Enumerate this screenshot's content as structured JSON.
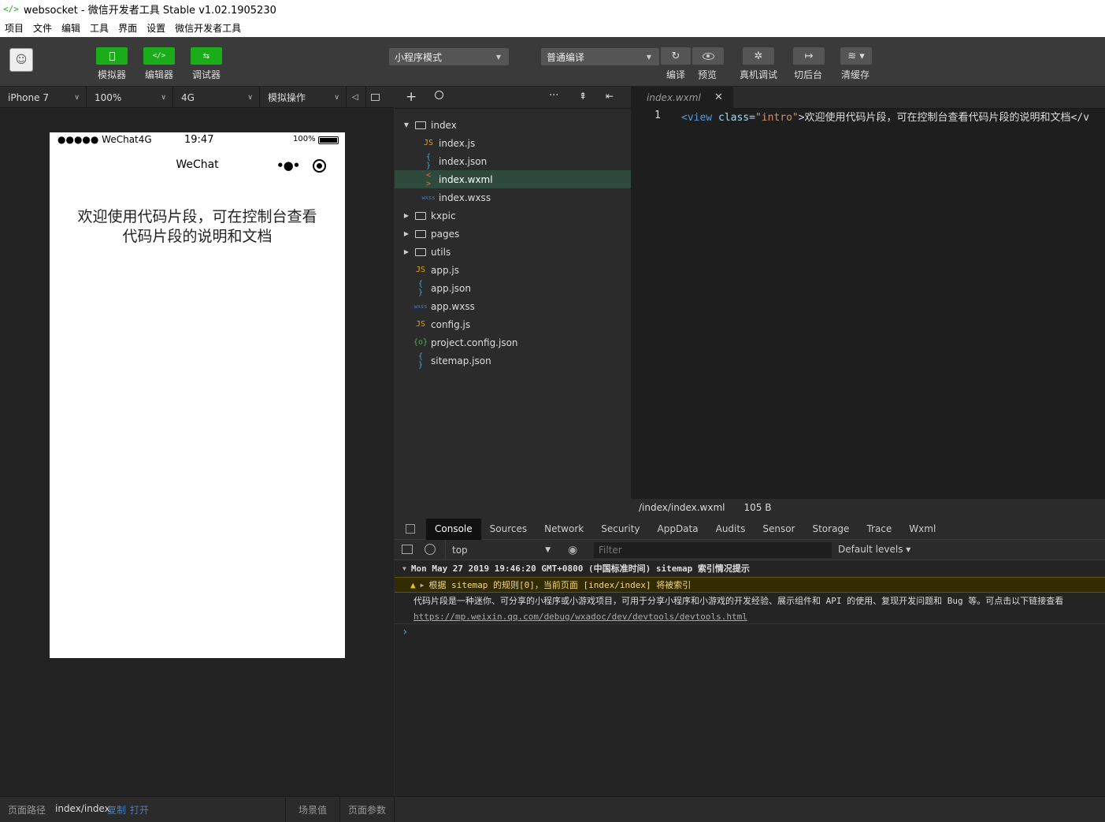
{
  "window": {
    "title": "websocket - 微信开发者工具 Stable v1.02.1905230"
  },
  "menu": [
    "项目",
    "文件",
    "编辑",
    "工具",
    "界面",
    "设置",
    "微信开发者工具"
  ],
  "toolbar": {
    "simulator_label": "模拟器",
    "editor_label": "编辑器",
    "debugger_label": "调试器",
    "mode_select": "小程序模式",
    "compile_select": "普通编译",
    "compile_label": "编译",
    "preview_label": "预览",
    "remote_debug_label": "真机调试",
    "background_label": "切后台",
    "clear_cache_label": "清缓存",
    "accent": "#1aad19"
  },
  "simbar": {
    "device": "iPhone 7",
    "zoom": "100%",
    "network": "4G",
    "ops": "模拟操作"
  },
  "phone": {
    "signal": "●●●●● WeChat4G",
    "time": "19:47",
    "battery": "100%",
    "nav_title": "WeChat",
    "intro_text": "欢迎使用代码片段，可在控制台查看代码片段的说明和文档"
  },
  "tree": {
    "items": [
      {
        "name": "index",
        "type": "folder-open",
        "depth": 0
      },
      {
        "name": "index.js",
        "type": "js",
        "depth": 1
      },
      {
        "name": "index.json",
        "type": "json",
        "depth": 1
      },
      {
        "name": "index.wxml",
        "type": "wxml",
        "depth": 1,
        "active": true
      },
      {
        "name": "index.wxss",
        "type": "wxss",
        "depth": 1
      },
      {
        "name": "kxpic",
        "type": "folder",
        "depth": 0
      },
      {
        "name": "pages",
        "type": "folder",
        "depth": 0
      },
      {
        "name": "utils",
        "type": "folder",
        "depth": 0
      },
      {
        "name": "app.js",
        "type": "js",
        "depth": 0
      },
      {
        "name": "app.json",
        "type": "json",
        "depth": 0
      },
      {
        "name": "app.wxss",
        "type": "wxss",
        "depth": 0
      },
      {
        "name": "config.js",
        "type": "js",
        "depth": 0
      },
      {
        "name": "project.config.json",
        "type": "config",
        "depth": 0
      },
      {
        "name": "sitemap.json",
        "type": "json",
        "depth": 0
      }
    ]
  },
  "editor": {
    "tab": "index.wxml",
    "line_number": "1",
    "code_tag_open": "<view",
    "code_attr": "class=",
    "code_value": "\"intro\"",
    "code_text": ">欢迎使用代码片段，可在控制台查看代码片段的说明和文档</v",
    "status_path": "/index/index.wxml",
    "status_size": "105 B"
  },
  "devtools": {
    "tabs": [
      "Console",
      "Sources",
      "Network",
      "Security",
      "AppData",
      "Audits",
      "Sensor",
      "Storage",
      "Trace",
      "Wxml"
    ],
    "context": "top",
    "filter_placeholder": "Filter",
    "levels": "Default levels ▾",
    "log_group": "Mon May 27 2019 19:46:20 GMT+0800 (中国标准时间) sitemap 索引情况提示",
    "warning": "根据 sitemap 的规则[0]，当前页面 [index/index] 将被索引",
    "info": "代码片段是一种迷你、可分享的小程序或小游戏项目，可用于分享小程序和小游戏的开发经验、展示组件和 API 的使用、复现开发问题和 Bug 等。可点击以下链接查看",
    "link": "https://mp.weixin.qq.com/debug/wxadoc/dev/devtools/devtools.html",
    "prompt": "›"
  },
  "bottom": {
    "path_label": "页面路径",
    "path_value": "index/index",
    "copy": "复制",
    "open": "打开",
    "scene_label": "场景值",
    "params_label": "页面参数"
  }
}
